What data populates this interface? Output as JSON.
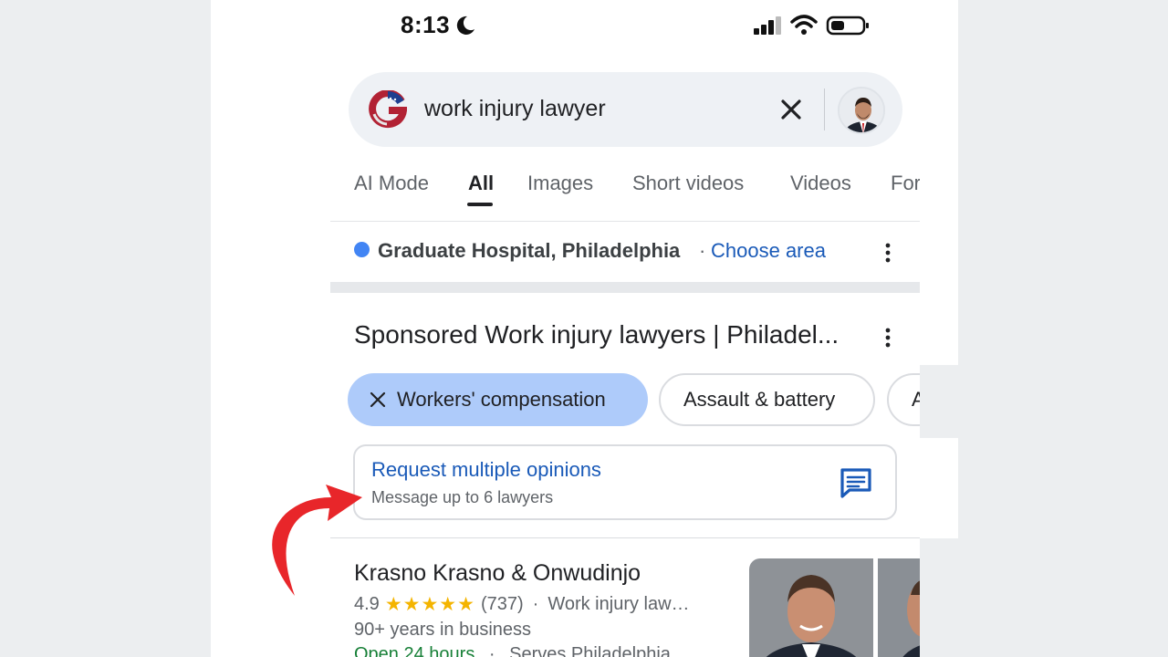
{
  "status_bar": {
    "time": "8:13"
  },
  "search": {
    "query": "work injury lawyer"
  },
  "tabs": [
    {
      "label": "AI Mode",
      "active": false
    },
    {
      "label": "All",
      "active": true
    },
    {
      "label": "Images",
      "active": false
    },
    {
      "label": "Short videos",
      "active": false
    },
    {
      "label": "Videos",
      "active": false
    },
    {
      "label": "For",
      "active": false
    }
  ],
  "location": {
    "place": "Graduate Hospital, Philadelphia",
    "separator": "·",
    "link": "Choose area"
  },
  "sponsored": {
    "title": "Sponsored Work injury lawyers | Philadel..."
  },
  "chips": [
    {
      "label": "Workers' compensation",
      "selected": true
    },
    {
      "label": "Assault & battery",
      "selected": false
    },
    {
      "label": "A",
      "selected": false
    }
  ],
  "request": {
    "title": "Request multiple opinions",
    "subtitle": "Message up to 6 lawyers"
  },
  "listing": {
    "name": "Krasno Krasno & Onwudinjo",
    "rating": "4.9",
    "stars": "★★★★★",
    "reviews": "(737)",
    "separator": "·",
    "category": "Work injury law…",
    "years": "90+ years in business",
    "open": "Open 24 hours",
    "serves": "Serves Philadelphia"
  },
  "colors": {
    "accent_blue": "#1a5ab8",
    "chip_selected": "#aecbfa",
    "star": "#f4b400",
    "arrow": "#e8262a"
  }
}
